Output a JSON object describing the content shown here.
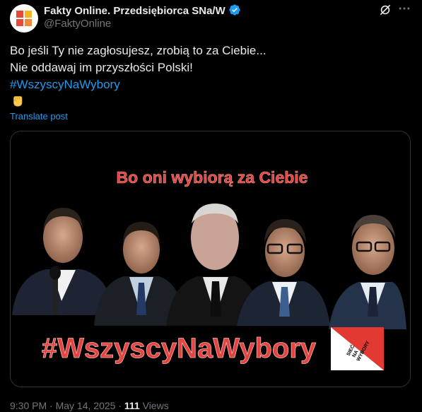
{
  "header": {
    "display_name": "Fakty Online. Przedsiębiorca SNa/W",
    "handle": "@FaktyOnline",
    "icons": [
      "verified-badge-icon",
      "grok-icon",
      "more-icon"
    ]
  },
  "post": {
    "lines": [
      "Bo jeśli Ty nie zagłosujesz, zrobią to za Ciebie...",
      "Nie oddawaj im przyszłości Polski!"
    ],
    "hashtag": "#WszyscyNaWybory",
    "emoji": "raised-fist-icon",
    "translate_label": "Translate post"
  },
  "media": {
    "headline": "Bo oni wybiorą za Ciebie",
    "hashtag_banner": "#WszyscyNaWybory",
    "logo_text": [
      "SIEĆ",
      "NA",
      "WYBORY"
    ],
    "colors": {
      "headline": "#e3443f",
      "background": "#000000"
    }
  },
  "footer": {
    "time": "9:30 PM",
    "separator": "·",
    "date": "May 14, 2025",
    "views_count": "111",
    "views_label": "Views"
  },
  "colors": {
    "link": "#1d9bf0",
    "muted": "#71767b",
    "text": "#e7e9ea"
  }
}
